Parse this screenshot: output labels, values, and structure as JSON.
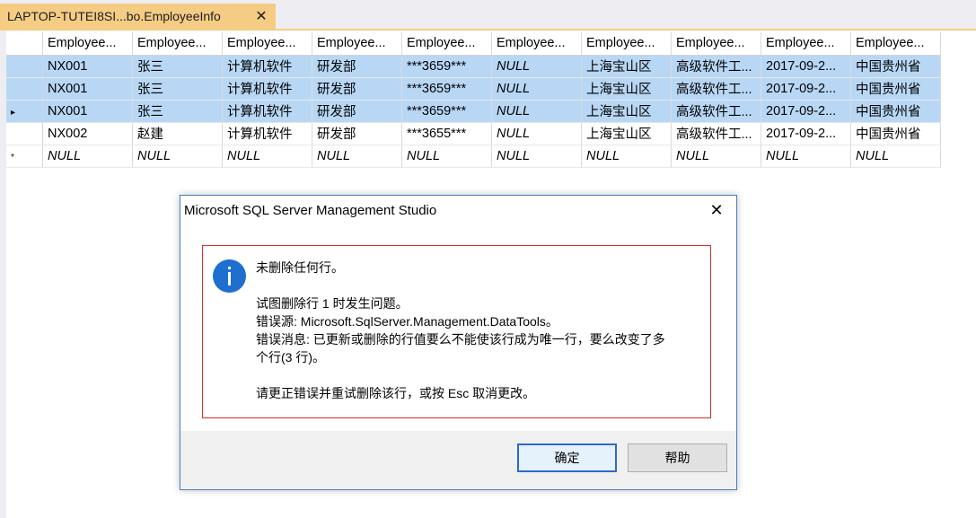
{
  "tab": {
    "title": "LAPTOP-TUTEI8SI...bo.EmployeeInfo",
    "close_glyph": "✕"
  },
  "grid": {
    "columns": [
      "Employee...",
      "Employee...",
      "Employee...",
      "Employee...",
      "Employee...",
      "Employee...",
      "Employee...",
      "Employee...",
      "Employee...",
      "Employee..."
    ],
    "rows": [
      {
        "selected": true,
        "indicator": "",
        "cells": [
          "NX001",
          "张三",
          "计算机软件",
          "研发部",
          "***3659***",
          "NULL",
          "上海宝山区",
          "高级软件工...",
          "2017-09-2...",
          "中国贵州省"
        ]
      },
      {
        "selected": true,
        "indicator": "",
        "cells": [
          "NX001",
          "张三",
          "计算机软件",
          "研发部",
          "***3659***",
          "NULL",
          "上海宝山区",
          "高级软件工...",
          "2017-09-2...",
          "中国贵州省"
        ]
      },
      {
        "selected": true,
        "indicator": "▸",
        "cells": [
          "NX001",
          "张三",
          "计算机软件",
          "研发部",
          "***3659***",
          "NULL",
          "上海宝山区",
          "高级软件工...",
          "2017-09-2...",
          "中国贵州省"
        ]
      },
      {
        "selected": false,
        "indicator": "",
        "cells": [
          "NX002",
          "赵建",
          "计算机软件",
          "研发部",
          "***3655***",
          "NULL",
          "上海宝山区",
          "高级软件工...",
          "2017-09-2...",
          "中国贵州省"
        ]
      },
      {
        "selected": false,
        "indicator": "*",
        "cells": [
          "NULL",
          "NULL",
          "NULL",
          "NULL",
          "NULL",
          "NULL",
          "NULL",
          "NULL",
          "NULL",
          "NULL"
        ]
      }
    ],
    "null_text": "NULL"
  },
  "dialog": {
    "title": "Microsoft SQL Server Management Studio",
    "close_glyph": "✕",
    "icon": "info-icon",
    "message": {
      "line1": "未删除任何行。",
      "line2": "试图删除行 1 时发生问题。",
      "line3": "错误源: Microsoft.SqlServer.Management.DataTools。",
      "line4": "错误消息: 已更新或删除的行值要么不能使该行成为唯一行，要么改变了多",
      "line5": "个行(3 行)。",
      "line6": "请更正错误并重试删除该行，或按 Esc 取消更改。"
    },
    "buttons": {
      "ok": "确定",
      "help": "帮助"
    }
  },
  "colors": {
    "tab_active": "#f5cc84",
    "selection": "#b8d7f5",
    "dialog_border": "#4a7fc0",
    "error_border": "#d92b2b",
    "info_icon": "#1f6fd1"
  }
}
